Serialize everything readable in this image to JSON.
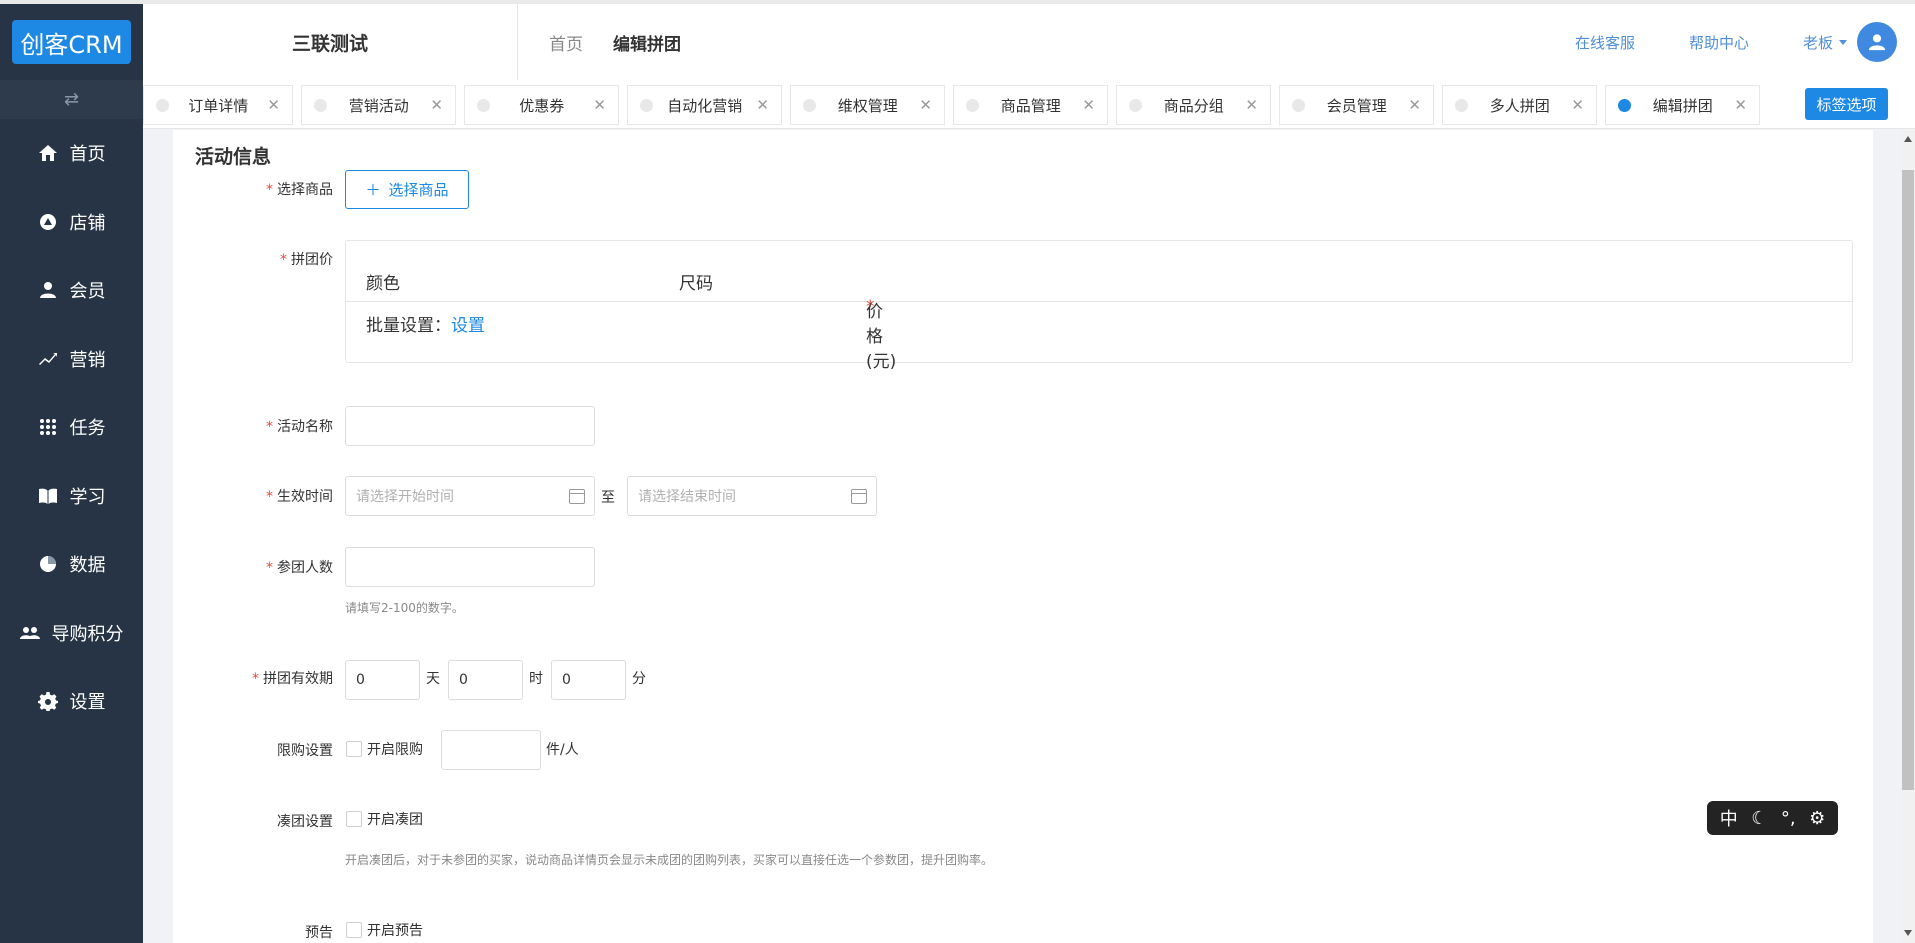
{
  "app": {
    "logo": "创客CRM",
    "shop_name": "三联测试"
  },
  "breadcrumb": {
    "home": "首页",
    "current": "编辑拼团"
  },
  "header": {
    "online_service": "在线客服",
    "help_center": "帮助中心",
    "user": "老板"
  },
  "sidebar": {
    "items": [
      {
        "label": "首页",
        "icon": "home-icon"
      },
      {
        "label": "店铺",
        "icon": "store-icon"
      },
      {
        "label": "会员",
        "icon": "user-icon"
      },
      {
        "label": "营销",
        "icon": "trend-icon"
      },
      {
        "label": "任务",
        "icon": "grid-icon"
      },
      {
        "label": "学习",
        "icon": "book-icon"
      },
      {
        "label": "数据",
        "icon": "pie-icon"
      },
      {
        "label": "导购积分",
        "icon": "group-icon"
      },
      {
        "label": "设置",
        "icon": "gear-icon"
      }
    ]
  },
  "tabs": [
    {
      "label": "订单详情",
      "active": false
    },
    {
      "label": "营销活动",
      "active": false
    },
    {
      "label": "优惠券",
      "active": false
    },
    {
      "label": "自动化营销",
      "active": false
    },
    {
      "label": "维权管理",
      "active": false
    },
    {
      "label": "商品管理",
      "active": false
    },
    {
      "label": "商品分组",
      "active": false
    },
    {
      "label": "会员管理",
      "active": false
    },
    {
      "label": "多人拼团",
      "active": false
    },
    {
      "label": "编辑拼团",
      "active": true
    }
  ],
  "tag_options": "标签选项",
  "form": {
    "section_title": "活动信息",
    "select_product": {
      "label": "选择商品",
      "button": "选择商品"
    },
    "group_price": {
      "label": "拼团价",
      "col_color": "颜色",
      "col_size": "尺码",
      "col_price": "价格(元)",
      "batch_label": "批量设置：",
      "batch_link": "设置"
    },
    "activity_name": {
      "label": "活动名称",
      "value": ""
    },
    "effective_time": {
      "label": "生效时间",
      "start_placeholder": "请选择开始时间",
      "to": "至",
      "end_placeholder": "请选择结束时间"
    },
    "participants": {
      "label": "参团人数",
      "value": "",
      "hint": "请填写2-100的数字。"
    },
    "validity": {
      "label": "拼团有效期",
      "days": "0",
      "days_unit": "天",
      "hours": "0",
      "hours_unit": "时",
      "minutes": "0",
      "minutes_unit": "分"
    },
    "purchase_limit": {
      "label": "限购设置",
      "checkbox_label": "开启限购",
      "value": "",
      "unit": "件/人"
    },
    "group_fill": {
      "label": "凑团设置",
      "checkbox_label": "开启凑团",
      "hint": "开启凑团后，对于未参团的买家，说动商品详情页会显示未成团的团购列表，买家可以直接任选一个参数团，提升团购率。"
    },
    "preview": {
      "label": "预告",
      "checkbox_label": "开启预告"
    }
  },
  "ime": {
    "mode": "中"
  }
}
